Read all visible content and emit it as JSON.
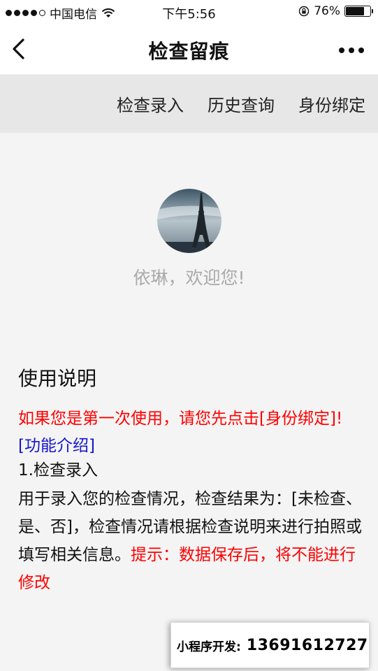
{
  "status_bar": {
    "carrier": "中国电信",
    "time": "下午5:56",
    "battery_percent": "76%",
    "battery_level": 0.76
  },
  "nav": {
    "title": "检查留痕",
    "back_icon": "chevron-left-icon",
    "more_icon": "more-dots-icon"
  },
  "tabs": [
    {
      "label": "检查录入"
    },
    {
      "label": "历史查询"
    },
    {
      "label": "身份绑定"
    }
  ],
  "profile": {
    "welcome": "依琳，欢迎您!"
  },
  "instructions": {
    "title": "使用说明",
    "first_use_notice": "如果您是第一次使用，请您先点击[身份绑定]!",
    "feature_link": "[功能介绍]",
    "item1_title": "1.检查录入",
    "item1_desc": "用于录入您的检查情况，检查结果为：[未检查、是、否]，检查情况请根据检查说明来进行拍照或填写相关信息。",
    "item1_tip": "提示：数据保存后，将不能进行修改"
  },
  "dev_banner": {
    "label": "小程序开发:",
    "phone": "13691612727"
  },
  "colors": {
    "notice_red": "#ff0000",
    "link_blue": "#1515cc",
    "tab_bg": "#e7e7e7",
    "page_bg": "#f4f4f4"
  }
}
